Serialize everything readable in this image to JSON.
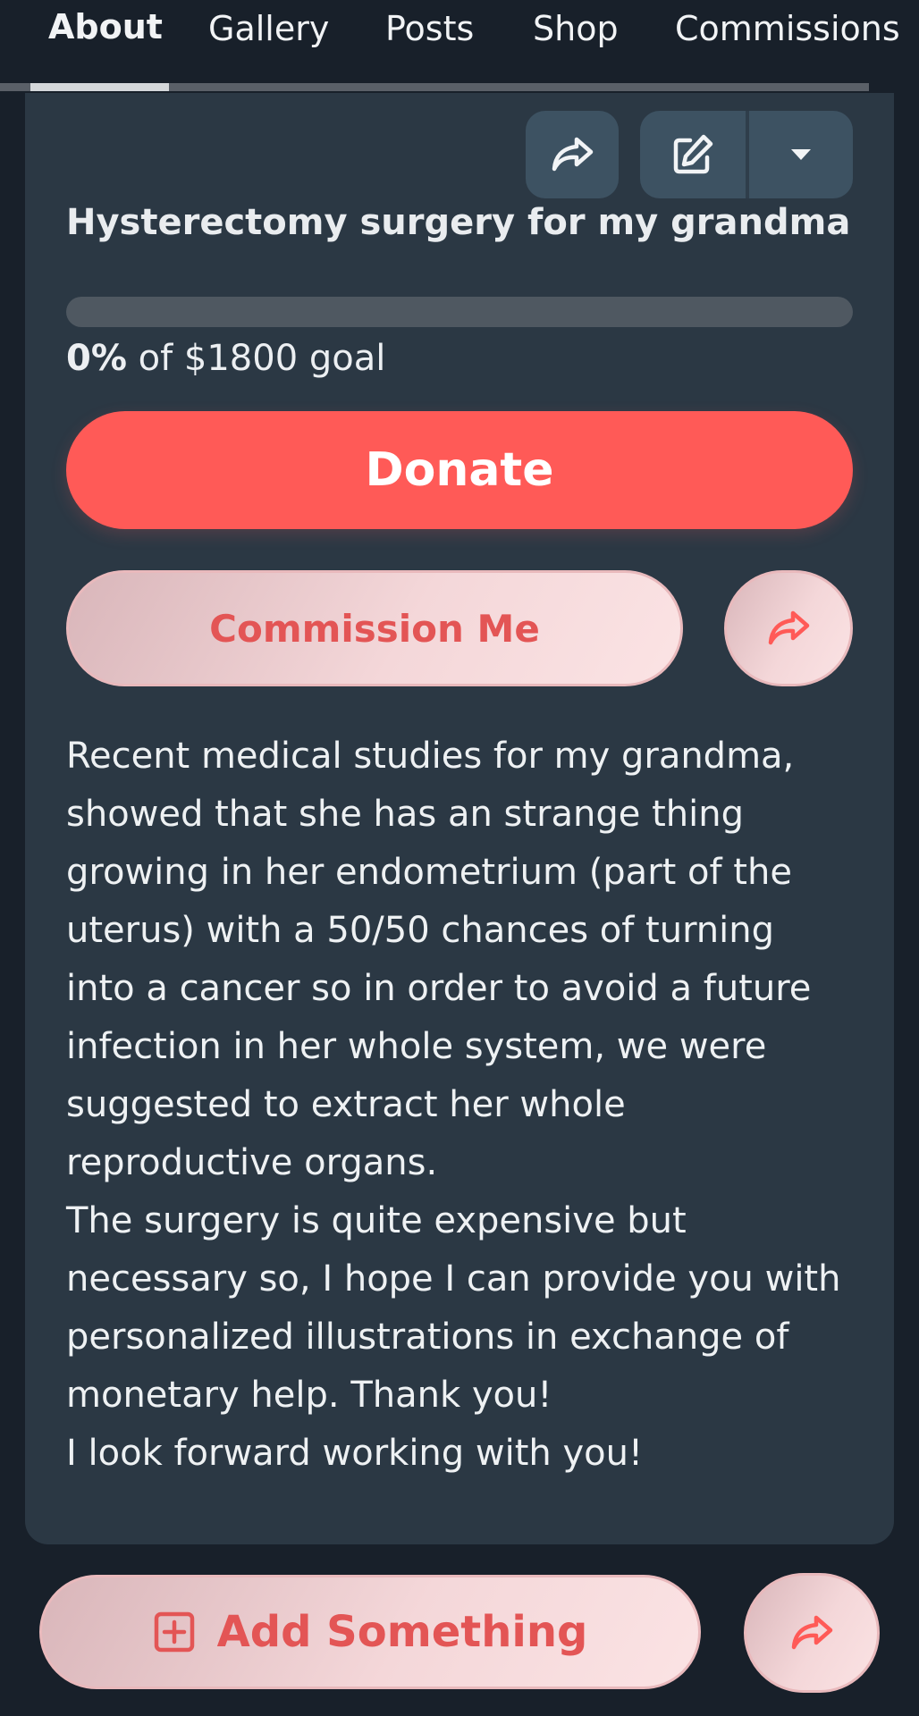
{
  "tabs": [
    {
      "label": "About",
      "active": true
    },
    {
      "label": "Gallery",
      "active": false
    },
    {
      "label": "Posts",
      "active": false
    },
    {
      "label": "Shop",
      "active": false
    },
    {
      "label": "Commissions",
      "active": false
    }
  ],
  "card": {
    "toolbar": {
      "share_icon": "share-icon",
      "edit_icon": "edit-icon",
      "dropdown_icon": "caret-down-icon"
    },
    "title": "Hysterectomy surgery for my grandma",
    "progress": {
      "fraction": 0,
      "percent_label": "0%",
      "goal_text": " of $1800 goal"
    },
    "donate_label": "Donate",
    "commission_label": "Commission Me",
    "description": [
      "Recent medical studies for my grandma, showed that she has an strange thing growing in her endometrium (part of the uterus) with a 50/50 chances of turning into a cancer so in order to avoid a future infection in her whole system, we were suggested to extract her whole reproductive organs.",
      "The surgery is quite expensive but necessary so, I hope I can provide you with personalized illustrations in exchange of monetary help. Thank you!",
      "I look forward working with you!"
    ]
  },
  "bottom": {
    "add_label": "Add Something",
    "add_icon": "plus-square-icon",
    "share_icon": "share-icon"
  },
  "colors": {
    "background": "#18202a",
    "card": "#2b3844",
    "accent": "#ff5a57",
    "button_dark": "#3d5262",
    "pill_text": "#e35555"
  }
}
